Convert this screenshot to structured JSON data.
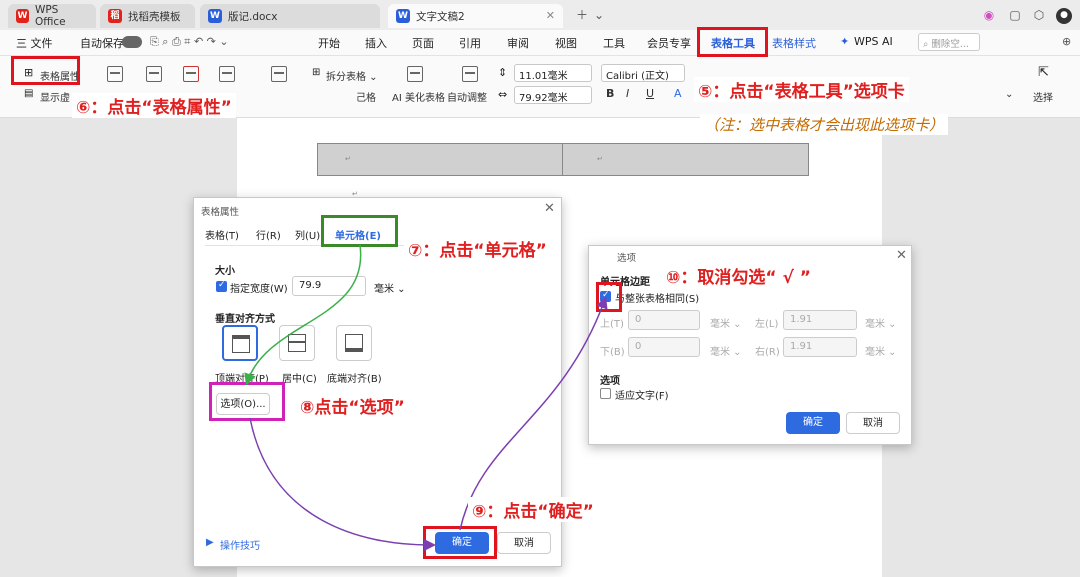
{
  "titlebar": {
    "tabs": [
      {
        "label": "WPS Office",
        "icon": "wps-logo-icon",
        "color": "#e0231b"
      },
      {
        "label": "找稻壳模板",
        "icon": "docer-icon",
        "color": "#e0231b"
      },
      {
        "label": "版记.docx",
        "icon": "word-icon",
        "color": "#2b5fd9"
      },
      {
        "label": "文字文稿2",
        "icon": "word-icon",
        "color": "#2b5fd9"
      }
    ]
  },
  "menubar": {
    "file": "三 文件",
    "autosave": "自动保存",
    "items": [
      "开始",
      "插入",
      "页面",
      "引用",
      "审阅",
      "视图",
      "工具",
      "会员专享",
      "表格工具",
      "表格样式",
      "WPS AI"
    ],
    "search_placeholder": "删除空..."
  },
  "ribbon": {
    "table_props": "表格属性",
    "show": "显示虚",
    "split_table": "拆分表格",
    "ai_beautify": "AI 美化表格",
    "auto_adjust": "自动调整",
    "width_value": "11.01毫米",
    "height_value": "79.92毫米",
    "font_name": "Calibri (正文)",
    "select": "选择"
  },
  "dialog1": {
    "title": "表格属性",
    "tabs": [
      "表格(T)",
      "行(R)",
      "列(U)",
      "单元格(E)"
    ],
    "size_title": "大小",
    "specify_width": "指定宽度(W)",
    "width_value": "79.9",
    "unit": "毫米",
    "valign_title": "垂直对齐方式",
    "valign": [
      "顶端对齐(P)",
      "居中(C)",
      "底端对齐(B)"
    ],
    "options_button": "选项(O)...",
    "tips": "操作技巧",
    "ok": "确定",
    "cancel": "取消"
  },
  "dialog2": {
    "title": "选项",
    "margins_title": "单元格边距",
    "same_as_table": "与整张表格相同(S)",
    "top": "上(T)",
    "top_val": "0",
    "bottom": "下(B)",
    "bottom_val": "0",
    "left": "左(L)",
    "left_val": "1.91",
    "right": "右(R)",
    "right_val": "1.91",
    "unit": "毫米",
    "options_title": "选项",
    "fit_text": "适应文字(F)",
    "ok": "确定",
    "cancel": "取消"
  },
  "annotations": {
    "step5": "⑤：点击“表格工具”选项卡",
    "note5": "（注：选中表格才会出现此选项卡）",
    "step6": "⑥：点击“表格属性”",
    "step7": "⑦：点击“单元格”",
    "step8": "⑧点击“选项”",
    "step9": "⑨：点击“确定”",
    "step10": "⑩：取消勾选“ √ ”"
  },
  "colors": {
    "accent": "#2f6be0",
    "annotation_red": "#e0141e",
    "annotation_green": "#3a8a2c",
    "annotation_magenta": "#d022b8",
    "arrow_purple": "#7b3fb0"
  }
}
